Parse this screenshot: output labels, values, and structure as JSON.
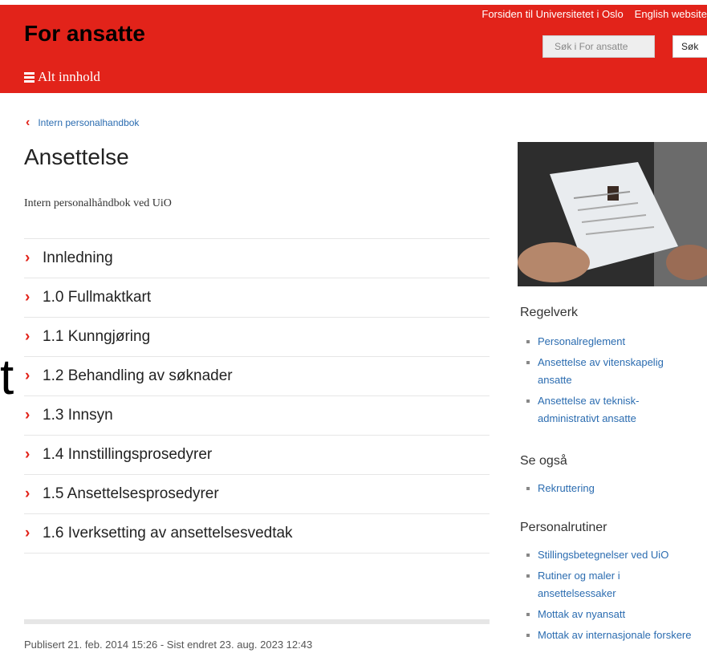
{
  "header": {
    "site_title": "For ansatte",
    "top_links": [
      "Forsiden til Universitetet i Oslo",
      "English website"
    ],
    "search_placeholder": "Søk i For ansatte",
    "search_button": "Søk",
    "menu_label": "Alt innhold"
  },
  "breadcrumb": {
    "label": "Intern personalhandbok"
  },
  "page": {
    "title": "Ansettelse",
    "lead": "Intern personalhåndbok ved UiO",
    "toc": [
      "Innledning",
      "1.0 Fullmaktkart",
      "1.1 Kunngjøring",
      "1.2 Behandling av søknader",
      "1.3 Innsyn",
      "1.4 Innstillingsprosedyrer",
      "1.5 Ansettelsesprosedyrer",
      "1.6 Iverksetting av ansettelsesvedtak"
    ],
    "ghost_glyph": "t",
    "meta": "Publisert 21. feb. 2014 15:26 - Sist endret 23. aug. 2023 12:43"
  },
  "sidebar": {
    "sections": [
      {
        "heading": "Regelverk",
        "links": [
          "Personalreglement",
          "Ansettelse av vitenskapelig ansatte",
          "Ansettelse av teknisk-administrativt ansatte"
        ]
      },
      {
        "heading": "Se også",
        "links": [
          "Rekruttering"
        ]
      },
      {
        "heading": "Personalrutiner",
        "links": [
          "Stillingsbetegnelser ved UiO",
          "Rutiner og maler i ansettelsessaker",
          "Mottak av nyansatt",
          "Mottak av internasjonale forskere"
        ]
      }
    ]
  },
  "colors": {
    "brand_red": "#e2231a",
    "link_blue": "#2b6cb0"
  }
}
